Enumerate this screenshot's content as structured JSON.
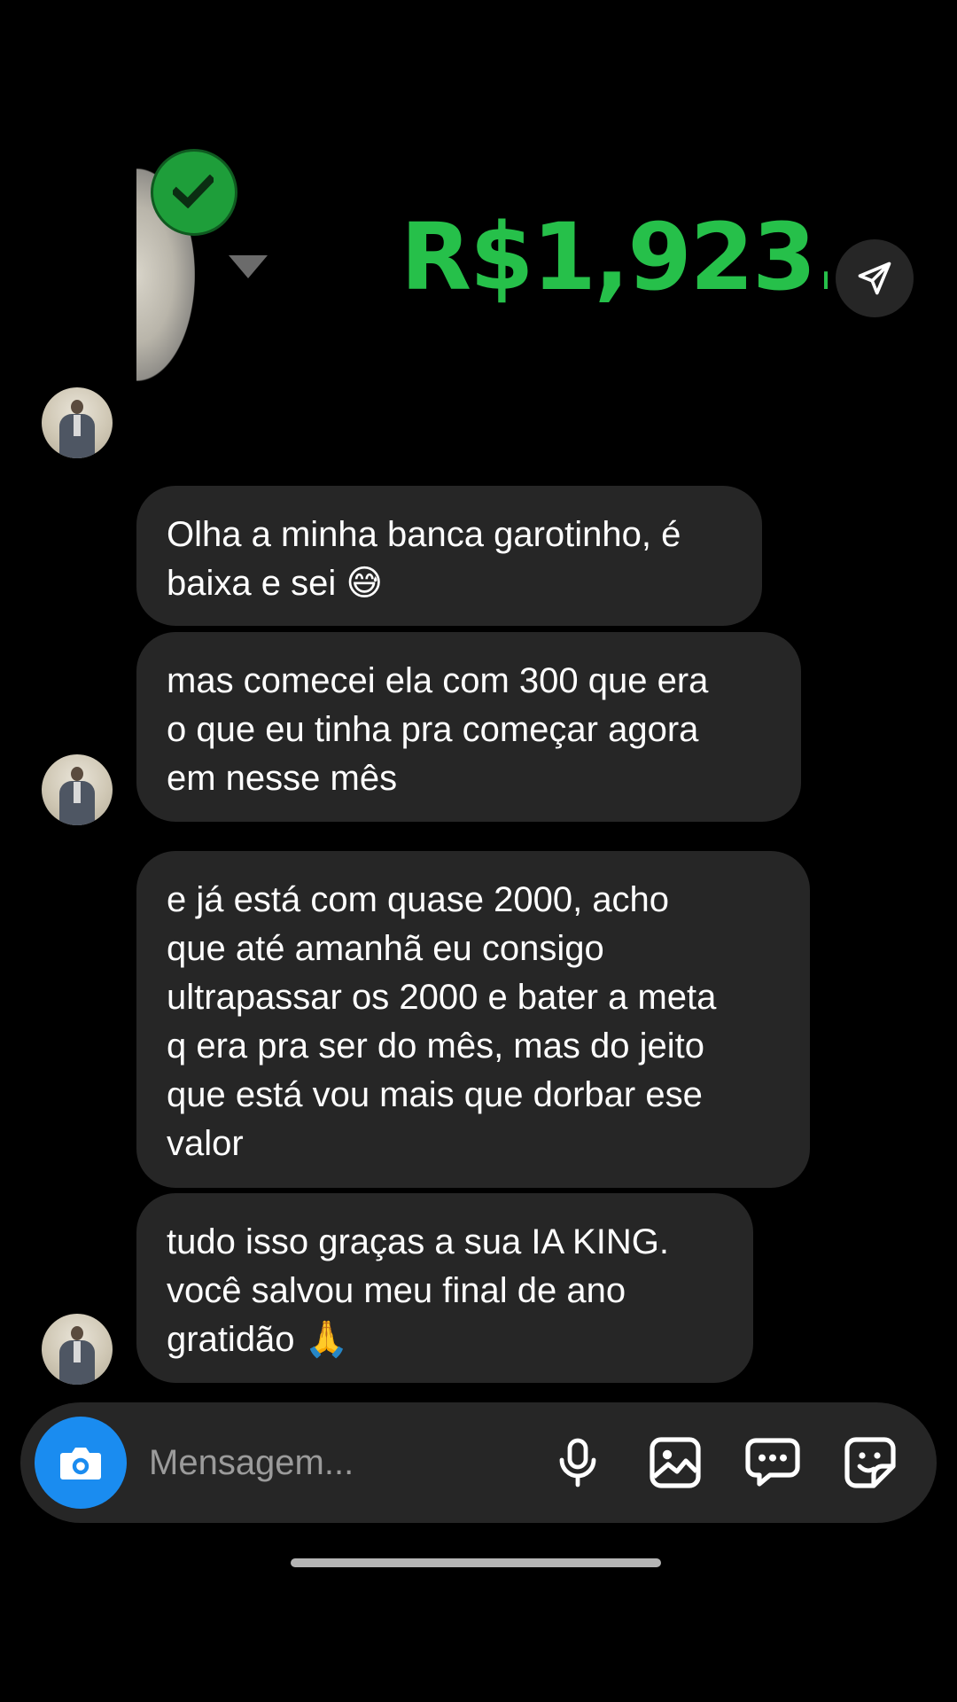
{
  "shared_image": {
    "balance": "R$1,923.",
    "icons": [
      "check-badge-icon",
      "dropdown-arrow-icon"
    ]
  },
  "share_button": {
    "icon": "paper-plane-icon"
  },
  "messages": [
    {
      "text": "Olha a minha banca garotinho, é\nbaixa e sei",
      "emoji": "😅"
    },
    {
      "text": "mas comecei ela com 300 que era\no que eu tinha pra começar agora\nem nesse mês"
    },
    {
      "text": "e já está com quase 2000, acho\nque até amanhã eu consigo\nultrapassar os 2000 e bater a meta\nq era pra ser do mês, mas do jeito\nque está vou mais que dorbar ese\nvalor"
    },
    {
      "text": "tudo isso graças a sua IA KING.\nvocê salvou meu final de ano\ngratidão",
      "emoji": "🙏"
    }
  ],
  "composer": {
    "placeholder": "Mensagem...",
    "icons": [
      "camera-icon",
      "microphone-icon",
      "gallery-icon",
      "chat-bubble-icon",
      "sticker-icon"
    ]
  },
  "colors": {
    "background": "#000000",
    "bubble": "#262626",
    "accent_blue": "#1a8cf0",
    "balance_green": "#26c04a",
    "placeholder_gray": "#9b9b9b"
  }
}
